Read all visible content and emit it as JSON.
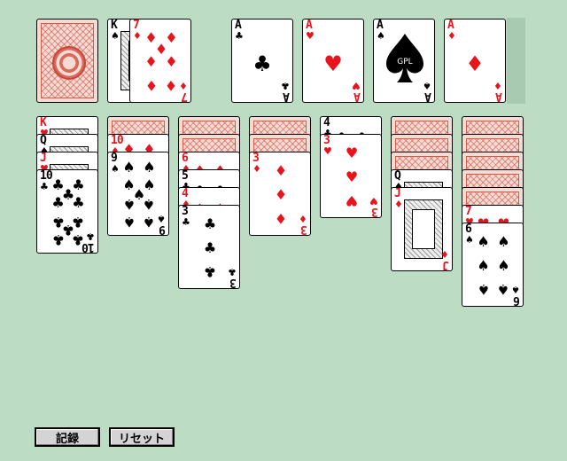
{
  "buttons": {
    "record": "記録",
    "reset": "リセット"
  },
  "colors": {
    "felt": "#bcdcc4",
    "red_suit": "#e8141c",
    "card_back": "#d45a4a"
  },
  "stock": {
    "face_down": true
  },
  "waste": [
    {
      "rank": "K",
      "suit": "♠",
      "color": "black"
    },
    {
      "rank": "7",
      "suit": "♦",
      "color": "red"
    }
  ],
  "foundations": [
    {
      "rank": "A",
      "suit": "♣",
      "color": "black"
    },
    {
      "rank": "A",
      "suit": "♥",
      "color": "red"
    },
    {
      "rank": "A",
      "suit": "♠",
      "color": "black",
      "logo": "GPL"
    },
    {
      "rank": "A",
      "suit": "♦",
      "color": "red"
    }
  ],
  "tableau": [
    {
      "down": 0,
      "up": [
        {
          "rank": "K",
          "suit": "♥",
          "color": "red"
        },
        {
          "rank": "Q",
          "suit": "♠",
          "color": "black"
        },
        {
          "rank": "J",
          "suit": "♥",
          "color": "red"
        },
        {
          "rank": "10",
          "suit": "♣",
          "color": "black"
        }
      ]
    },
    {
      "down": 1,
      "up": [
        {
          "rank": "10",
          "suit": "♦",
          "color": "red"
        },
        {
          "rank": "9",
          "suit": "♠",
          "color": "black"
        }
      ]
    },
    {
      "down": 2,
      "up": [
        {
          "rank": "6",
          "suit": "♦",
          "color": "red"
        },
        {
          "rank": "5",
          "suit": "♣",
          "color": "black"
        },
        {
          "rank": "4",
          "suit": "♦",
          "color": "red"
        },
        {
          "rank": "3",
          "suit": "♣",
          "color": "black"
        }
      ]
    },
    {
      "down": 2,
      "up": [
        {
          "rank": "3",
          "suit": "♦",
          "color": "red"
        }
      ]
    },
    {
      "down": 0,
      "up": [
        {
          "rank": "4",
          "suit": "♣",
          "color": "black"
        },
        {
          "rank": "3",
          "suit": "♥",
          "color": "red"
        }
      ]
    },
    {
      "down": 3,
      "up": [
        {
          "rank": "Q",
          "suit": "♠",
          "color": "black"
        },
        {
          "rank": "J",
          "suit": "♦",
          "color": "red"
        }
      ]
    },
    {
      "down": 5,
      "up": [
        {
          "rank": "7",
          "suit": "♥",
          "color": "red"
        },
        {
          "rank": "6",
          "suit": "♠",
          "color": "black"
        }
      ]
    }
  ]
}
